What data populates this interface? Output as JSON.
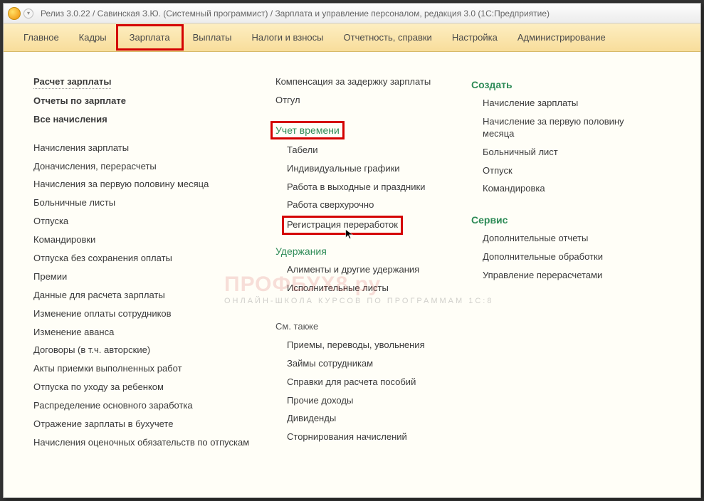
{
  "window_title": "Релиз 3.0.22 / Савинская З.Ю. (Системный программист) / Зарплата и управление персоналом, редакция 3.0  (1С:Предприятие)",
  "nav": [
    "Главное",
    "Кадры",
    "Зарплата",
    "Выплаты",
    "Налоги и взносы",
    "Отчетность, справки",
    "Настройка",
    "Администрирование"
  ],
  "col1_top": [
    {
      "t": "Расчет зарплаты",
      "bold": true,
      "dotted": true
    },
    {
      "t": "Отчеты по зарплате",
      "bold": true
    },
    {
      "t": "Все начисления",
      "bold": true
    }
  ],
  "col1_items": [
    "Начисления зарплаты",
    "Доначисления, перерасчеты",
    "Начисления за первую половину месяца",
    "Больничные листы",
    "Отпуска",
    "Командировки",
    "Отпуска без сохранения оплаты",
    "Премии",
    "Данные для расчета зарплаты",
    "Изменение оплаты сотрудников",
    "Изменение аванса",
    "Договоры (в т.ч. авторские)",
    "Акты приемки выполненных работ",
    "Отпуска по уходу за ребенком",
    "Распределение основного заработка",
    "Отражение зарплаты в бухучете",
    "Начисления оценочных обязательств по отпускам"
  ],
  "col2_top": [
    "Компенсация за задержку зарплаты",
    "Отгул"
  ],
  "sect_time": "Учет времени",
  "col2_time": [
    "Табели",
    "Индивидуальные графики",
    "Работа в выходные и праздники",
    "Работа сверхурочно",
    "Регистрация переработок"
  ],
  "sect_hold": "Удержания",
  "col2_hold": [
    "Алименты и другие удержания",
    "Исполнительные листы"
  ],
  "sect_see": "См. также",
  "col2_see": [
    "Приемы, переводы, увольнения",
    "Займы сотрудникам",
    "Справки для расчета пособий",
    "Прочие доходы",
    "Дивиденды",
    "Сторнирования начислений"
  ],
  "sect_create": "Создать",
  "col3_create": [
    "Начисление зарплаты",
    "Начисление за первую половину месяца",
    "Больничный лист",
    "Отпуск",
    "Командировка"
  ],
  "sect_service": "Сервис",
  "col3_service": [
    "Дополнительные отчеты",
    "Дополнительные обработки",
    "Управление перерасчетами"
  ],
  "watermark_main": "ПРОФБУХ8.ру",
  "watermark_sub": "ОНЛАЙН-ШКОЛА КУРСОВ ПО ПРОГРАММАМ 1С:8"
}
